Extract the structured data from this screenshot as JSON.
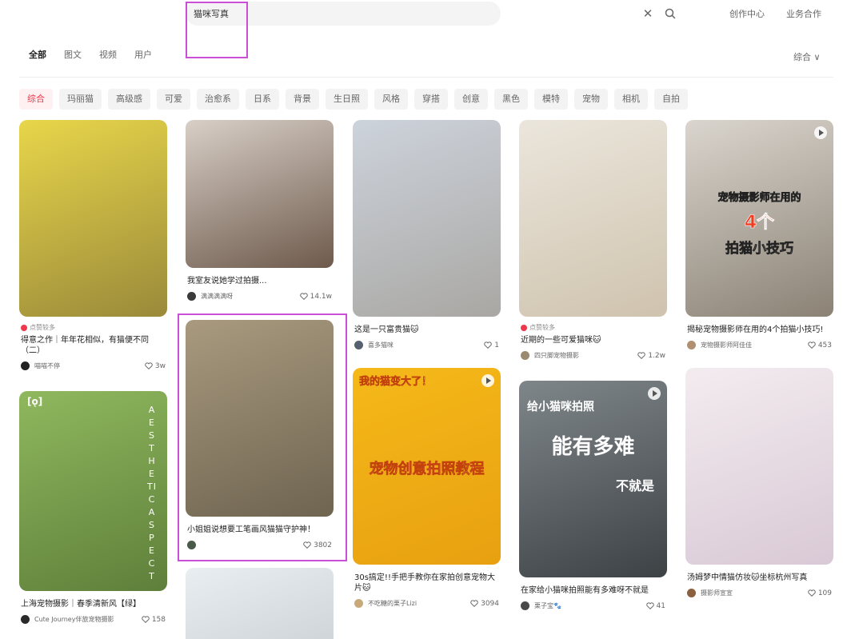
{
  "search": {
    "value": "猫咪写真"
  },
  "header": {
    "creator_center": "创作中心",
    "business": "业务合作"
  },
  "tabs": [
    "全部",
    "图文",
    "视频",
    "用户"
  ],
  "sort": {
    "label": "综合 ∨"
  },
  "chips": [
    "综合",
    "玛丽猫",
    "高级感",
    "可爱",
    "治愈系",
    "日系",
    "背景",
    "生日照",
    "风格",
    "穿搭",
    "创意",
    "黑色",
    "模特",
    "宠物",
    "相机",
    "自拍"
  ],
  "cards": [
    {
      "hot": "点赞较多",
      "title": "得意之作｜年年花相似，有猫便不同（二）",
      "author": "喵喵不停",
      "likes": "3w",
      "cover_colors": [
        "#e8d64a",
        "#9a8a3a"
      ]
    },
    {
      "title": "上海宠物摄影｜春季清新风【绿】",
      "author": "Cute Journey伴旅宠物摄影",
      "likes": "158",
      "cover_colors": [
        "#8fb85e",
        "#5e7f3a"
      ],
      "overlay_top": "[ǫ]",
      "overlay_side": "AESTHETIC ASPECT"
    },
    {
      "title": "我室友说她学过拍摄...",
      "author": "满满满满呀",
      "likes": "14.1w",
      "cover_colors": [
        "#d8cfc7",
        "#6e5a4c"
      ]
    },
    {
      "title": "小姐姐说想要工笔画风猫猫守护神！",
      "author": "",
      "likes": "3802",
      "cover_colors": [
        "#a99a7f",
        "#6e6450"
      ]
    },
    {
      "title": "",
      "author": "",
      "likes": "",
      "cover_colors": [
        "#e9eef1",
        "#cfd5d9"
      ]
    },
    {
      "title": "这是一只富贵猫🐱",
      "author": "喜多猫咪",
      "likes": "1",
      "cover_colors": [
        "#cdd3dc",
        "#a9a7a3"
      ]
    },
    {
      "title": "30s搞定!!手把手教你在家拍创意宠物大片🐱",
      "author": "不吃糖的栗子Lizi",
      "likes": "3094",
      "cover_colors": [
        "#f5b919",
        "#e8a010"
      ],
      "overlay_top": "我的猫变大了！",
      "overlay_mid": "宠物创意拍照教程"
    },
    {
      "hot": "点赞较多",
      "title": "近期的一些可爱猫咪🐱",
      "author": "四只脚宠物摄影",
      "likes": "1.2w",
      "cover_colors": [
        "#ebe6dc",
        "#cfc3ae"
      ]
    },
    {
      "title": "在家给小猫咪拍照能有多难呀不就是",
      "author": "栗子宝🐾",
      "likes": "41",
      "cover_colors": [
        "#7f8689",
        "#3d4245"
      ],
      "overlay_top": "给小猫咪拍照",
      "overlay_mid": "能有多难",
      "overlay_bottom": "不就是"
    },
    {
      "title": "揭秘宠物摄影师在用的4个拍猫小技巧!",
      "author": "宠物摄影师阿佳佳",
      "likes": "453",
      "cover_colors": [
        "#dad5ce",
        "#8b8275"
      ],
      "overlay_top": "宠物摄影师在用的",
      "overlay_mid": "4个",
      "overlay_bottom": "拍猫小技巧"
    },
    {
      "title": "汤姆梦中情猫仿妆🐱坐标杭州写真",
      "author": "摄影师宣宣",
      "likes": "109",
      "cover_colors": [
        "#f3ecef",
        "#d9c9d6"
      ]
    }
  ]
}
